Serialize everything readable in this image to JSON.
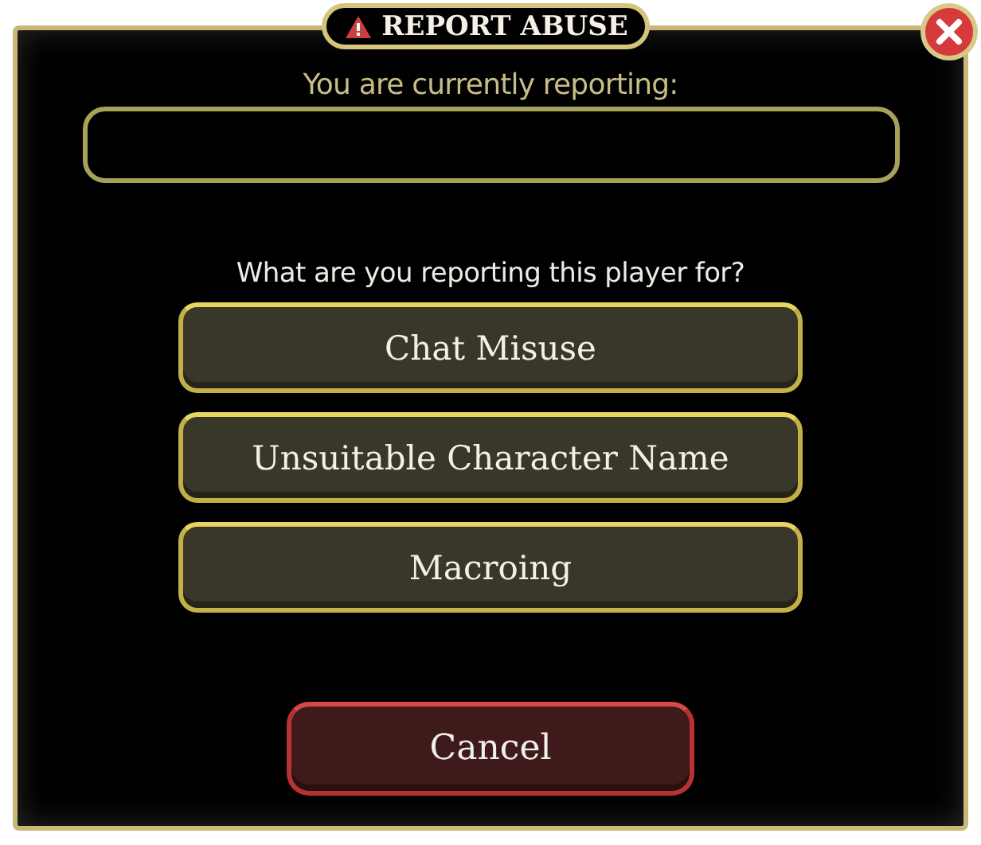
{
  "window": {
    "title": "REPORT ABUSE"
  },
  "reporting_label": "You are currently reporting:",
  "question": "What are you reporting this player for?",
  "options": [
    "Chat Misuse",
    "Unsuitable Character Name",
    "Macroing"
  ],
  "cancel_button": "Cancel"
}
